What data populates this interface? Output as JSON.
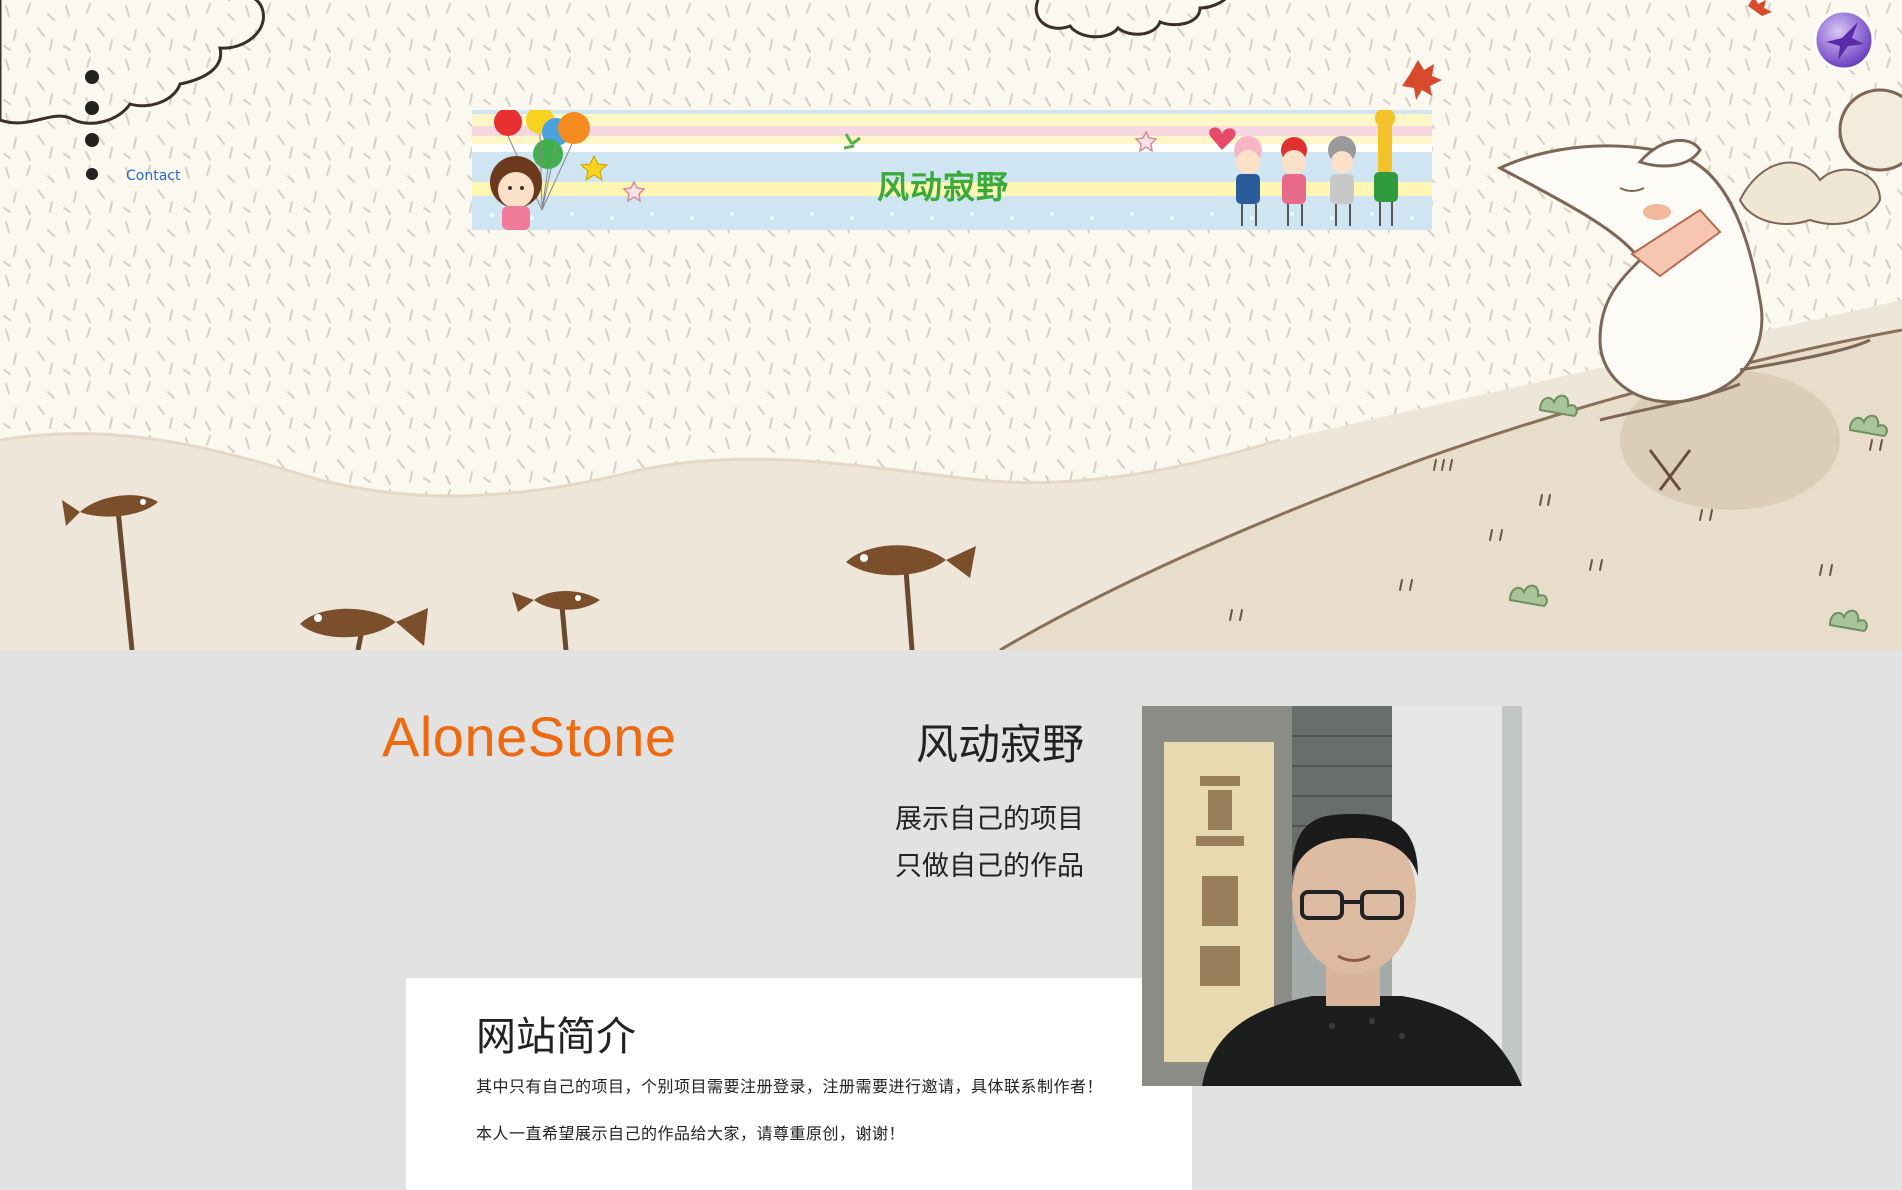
{
  "nav": {
    "dots": [
      "section-1",
      "section-2",
      "section-3"
    ],
    "contact_label": "Contact"
  },
  "banner": {
    "title": "风动寂野"
  },
  "brand": {
    "name": "AloneStone",
    "color": "#ee6a10"
  },
  "tagline": {
    "name": "风动寂野",
    "line1": "展示自己的项目",
    "line2": "只做自己的作品"
  },
  "intro": {
    "heading": "网站简介",
    "paragraph1": "其中只有自己的项目，个别项目需要注册登录，注册需要进行邀请，具体联系制作者！",
    "paragraph2": "本人一直希望展示自己的作品给大家，请尊重原创，谢谢！"
  },
  "colors": {
    "page_background": "#e2e2e2",
    "hero_background": "#fbf8f0",
    "hill": "#e8dccb",
    "contact_link": "#2a6bc4",
    "banner_title": "#3aaa3a"
  },
  "icons": {
    "logo": "purple-bird-logo-icon",
    "portrait": "portrait-photo"
  }
}
